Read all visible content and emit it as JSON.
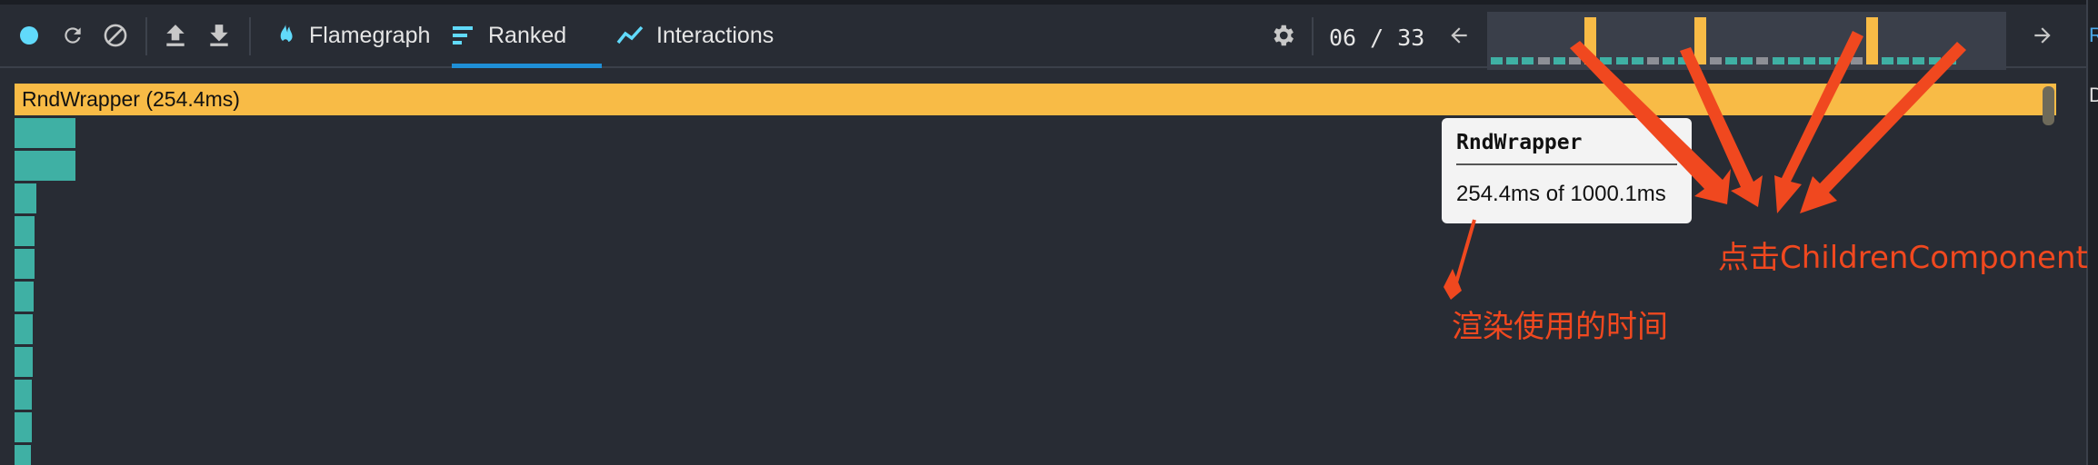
{
  "toolbar": {
    "icons": [
      "record-icon",
      "reload-icon",
      "clear-icon",
      "import-icon",
      "export-icon"
    ],
    "tabs": [
      {
        "label": "Flamegraph",
        "icon": "flame-icon",
        "active": false
      },
      {
        "label": "Ranked",
        "icon": "ranked-icon",
        "active": true
      },
      {
        "label": "Interactions",
        "icon": "interactions-icon",
        "active": false
      }
    ],
    "settings_icon": "gear-icon",
    "commit_counter": "06 / 33",
    "prev_icon": "arrow-left-icon",
    "next_icon": "arrow-right-icon",
    "snapshot_bars": {
      "count": 30,
      "highlighted": [
        6,
        13,
        24,
        31
      ],
      "selected_index": 6
    }
  },
  "ranked": {
    "root": {
      "label": "RndWrapper (254.4ms)"
    },
    "child_count": 11
  },
  "tooltip": {
    "title": "RndWrapper",
    "time": "254.4ms of 1000.1ms"
  },
  "annotations": {
    "render_time": "渲染使用的时间",
    "click_children": "点击ChildrenComponent"
  },
  "side_panel": {
    "heading_fragment": "R",
    "line_fragment": "D"
  },
  "colors": {
    "background": "#282c34",
    "root_bar": "#f8bb46",
    "child_bar": "#3fb0a4",
    "accent_blue": "#61dafb",
    "tab_underline": "#1f8fd6",
    "annotation_red": "#f0481f"
  }
}
